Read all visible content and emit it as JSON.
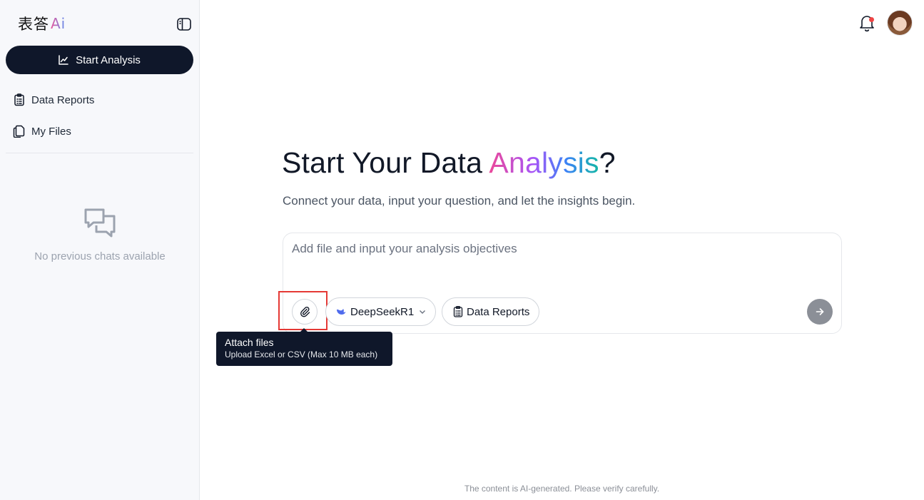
{
  "sidebar": {
    "logo": {
      "text": "表答",
      "ai": "Ai"
    },
    "start_button": "Start Analysis",
    "nav": [
      {
        "label": "Data Reports",
        "icon": "clipboard-icon"
      },
      {
        "label": "My Files",
        "icon": "files-icon"
      }
    ],
    "empty_state": "No previous chats available"
  },
  "header": {
    "notification_icon": "bell-icon",
    "avatar_icon": "user-avatar"
  },
  "main": {
    "headline_prefix": "Start Your Data ",
    "headline_highlight": "Analysis",
    "headline_suffix": "?",
    "subtitle": "Connect your data, input your question, and let the insights begin.",
    "composer": {
      "placeholder": "Add file and input your analysis objectives",
      "model_label": "DeepSeekR1",
      "reports_label": "Data Reports"
    },
    "tooltip": {
      "title": "Attach files",
      "description": "Upload Excel or CSV (Max 10 MB each)"
    },
    "footer_note": "The content is AI-generated. Please verify carefully."
  },
  "colors": {
    "primary_dark": "#0f172a",
    "highlight_red": "#e53935",
    "send_gray": "#8b8f97",
    "notification_dot": "#ef4444"
  }
}
